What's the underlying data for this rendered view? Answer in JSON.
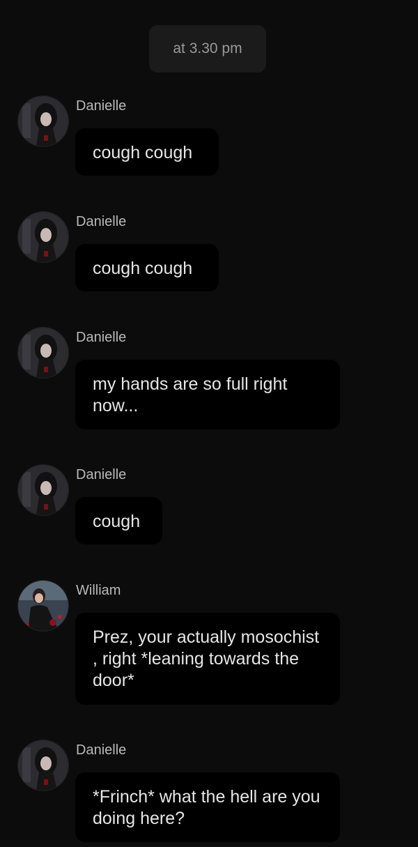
{
  "timestamp": "at 3.30 pm",
  "messages": [
    {
      "sender": "Danielle",
      "avatar": "danielle-avatar",
      "text": "cough cough"
    },
    {
      "sender": "Danielle",
      "avatar": "danielle-avatar",
      "text": "cough cough"
    },
    {
      "sender": "Danielle",
      "avatar": "danielle-avatar",
      "text": "my hands are so full right now..."
    },
    {
      "sender": "Danielle",
      "avatar": "danielle-avatar",
      "text": "cough"
    },
    {
      "sender": "William",
      "avatar": "william-avatar",
      "text": "Prez, your actually mosochist , right *leaning towards the door*"
    },
    {
      "sender": "Danielle",
      "avatar": "danielle-avatar",
      "text": "*Frinch* what the hell are you doing here?"
    }
  ],
  "colors": {
    "background": "#0c0c0c",
    "bubble": "#000000",
    "timestamp_bg": "#1b1b1b",
    "name_text": "#b9b9b9",
    "message_text": "#e6e6e6"
  }
}
